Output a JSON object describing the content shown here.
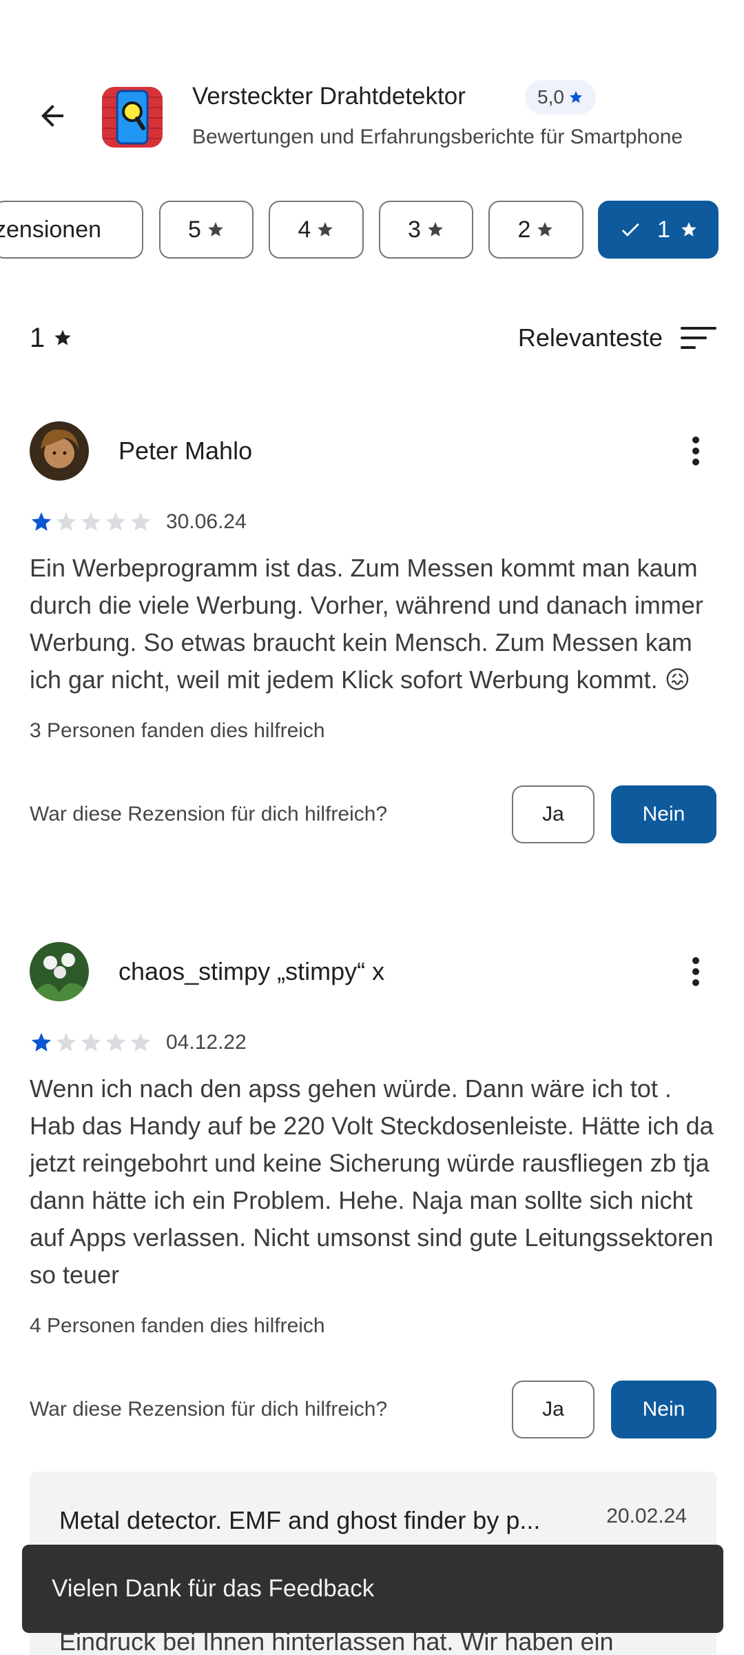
{
  "header": {
    "app_title": "Versteckter Drahtdetektor",
    "rating": "5,0",
    "subtitle": "Bewertungen und Erfahrungsberichte für Smartphone"
  },
  "filters": {
    "chips": [
      {
        "label": "zensionen",
        "selected": false
      },
      {
        "label": "5",
        "selected": false
      },
      {
        "label": "4",
        "selected": false
      },
      {
        "label": "3",
        "selected": false
      },
      {
        "label": "2",
        "selected": false
      },
      {
        "label": "1",
        "selected": true
      }
    ],
    "active_filter": "1",
    "sort_label": "Relevanteste"
  },
  "reviews": [
    {
      "name": "Peter Mahlo",
      "rating": 1,
      "date": "30.06.24",
      "text": "Ein Werbeprogramm ist das. Zum Messen kommt man kaum durch die viele Werbung. Vorher, während und danach immer Werbung. So etwas braucht kein Mensch. Zum Messen kam ich gar nicht, weil mit jedem Klick sofort Werbung kommt. 😖",
      "helpful_count": "3 Personen fanden dies hilfreich",
      "helpful_question": "War diese Rezension für dich hilfreich?",
      "yes_label": "Ja",
      "no_label": "Nein"
    },
    {
      "name": "chaos_stimpy „stimpy“ x",
      "rating": 1,
      "date": "04.12.22",
      "text": "Wenn ich nach den apss gehen würde. Dann wäre ich tot . Hab das Handy auf be 220 Volt Steckdosenleiste. Hätte ich da jetzt reingebohrt und keine Sicherung würde rausfliegen zb tja dann hätte ich ein Problem. Hehe. Naja man sollte sich nicht auf Apps verlassen. Nicht umsonst sind gute Leitungssektoren so teuer",
      "helpful_count": "4 Personen fanden dies hilfreich",
      "helpful_question": "War diese Rezension für dich hilfreich?",
      "yes_label": "Ja",
      "no_label": "Nein"
    }
  ],
  "developer_reply": {
    "name": "Metal detector. EMF and ghost finder by p...",
    "date": "20.02.24",
    "text_partial": "Eindruck bei Ihnen hinterlassen hat. Wir haben ein"
  },
  "snackbar": {
    "message": "Vielen Dank für das Feedback"
  },
  "colors": {
    "accent": "#0e5a9c",
    "star_filled": "#0b57d0",
    "star_empty": "#dadce0",
    "snackbar_bg": "#313131"
  }
}
